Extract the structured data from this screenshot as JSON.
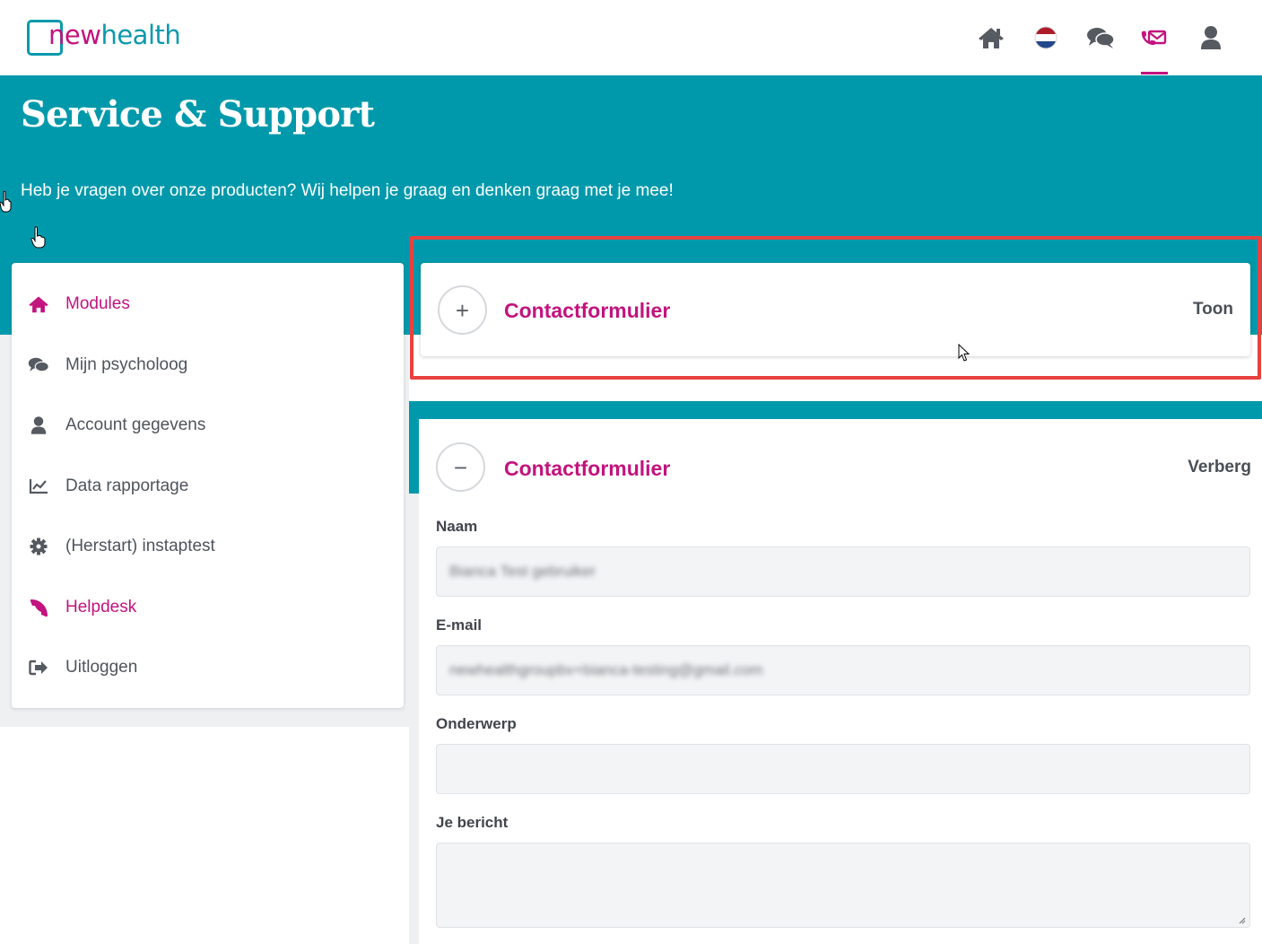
{
  "brand": {
    "logo_part1": "new",
    "logo_part2": "health"
  },
  "nav": {
    "icons": [
      "home-icon",
      "dutch-flag-icon",
      "chat-icon",
      "contact-mail-icon",
      "user-icon"
    ],
    "active": "contact-mail-icon"
  },
  "banner": {
    "title": "Service & Support",
    "subtitle": "Heb je vragen over onze producten? Wij helpen je graag en denken graag met je mee!"
  },
  "sidebar": {
    "items": [
      {
        "label": "Modules",
        "icon": "home-icon",
        "active": true
      },
      {
        "label": "Mijn psycholoog",
        "icon": "chat-icon",
        "active": false
      },
      {
        "label": "Account gegevens",
        "icon": "user-icon",
        "active": false
      },
      {
        "label": "Data rapportage",
        "icon": "line-chart-icon",
        "active": false
      },
      {
        "label": "(Herstart) instaptest",
        "icon": "gear-icon",
        "active": false
      },
      {
        "label": "Helpdesk",
        "icon": "phone-icon",
        "active": true
      },
      {
        "label": "Uitloggen",
        "icon": "logout-icon",
        "active": false
      }
    ]
  },
  "collapsed_card": {
    "title": "Contactformulier",
    "toggle": "Toon",
    "button_symbol": "+"
  },
  "expanded_card": {
    "title": "Contactformulier",
    "toggle": "Verberg",
    "button_symbol": "−",
    "fields": [
      {
        "label": "Naam",
        "value": "Bianca Test gebruiker"
      },
      {
        "label": "E-mail",
        "value": "newhealthgroupbv+bianca-testing@gmail.com"
      },
      {
        "label": "Onderwerp",
        "value": ""
      },
      {
        "label": "Je bericht",
        "value": ""
      }
    ]
  },
  "colors": {
    "teal": "#0099ab",
    "magenta": "#c2137e",
    "highlight": "#e8413f"
  }
}
